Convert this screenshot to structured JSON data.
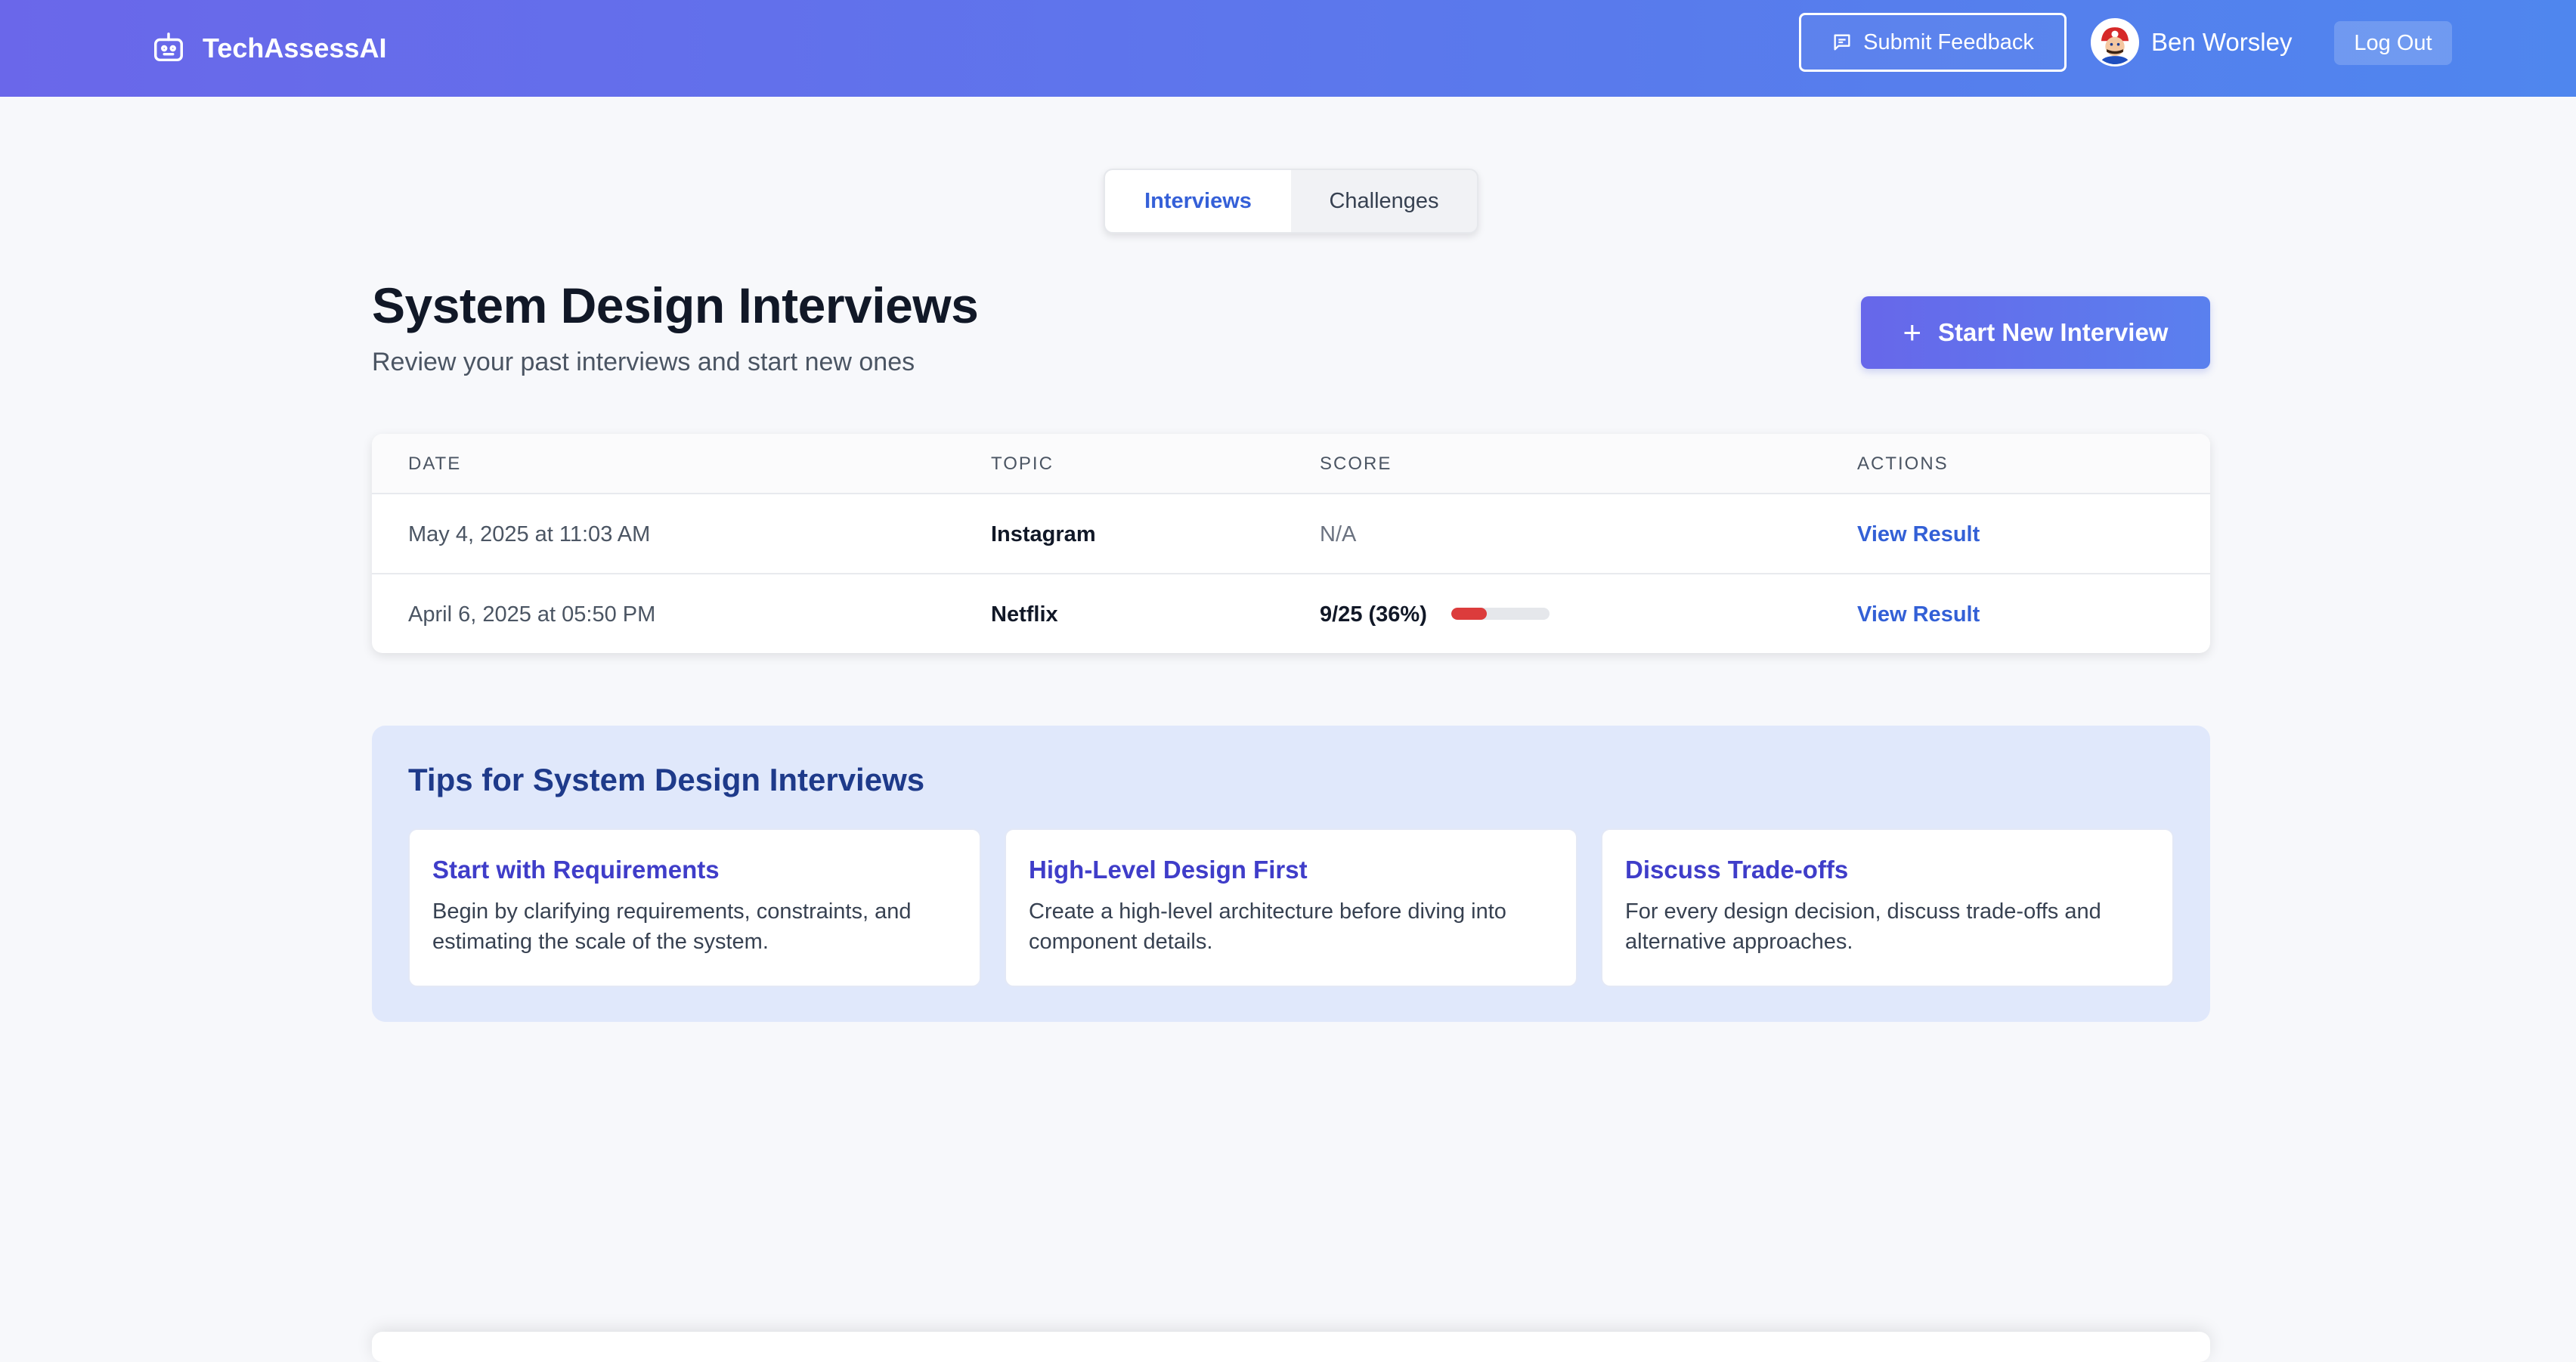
{
  "header": {
    "brand": "TechAssessAI",
    "brand_icon": "robot-icon",
    "feedback_label": "Submit Feedback",
    "feedback_icon": "message-icon",
    "user_name": "Ben Worsley",
    "logout_label": "Log Out"
  },
  "tabs": [
    {
      "label": "Interviews",
      "active": true
    },
    {
      "label": "Challenges",
      "active": false
    }
  ],
  "page": {
    "title": "System Design Interviews",
    "subtitle": "Review your past interviews and start new ones",
    "start_button": "Start New Interview",
    "start_icon": "plus-icon"
  },
  "table": {
    "headers": [
      "DATE",
      "TOPIC",
      "SCORE",
      "ACTIONS"
    ],
    "rows": [
      {
        "date": "May 4, 2025 at 11:03 AM",
        "topic": "Instagram",
        "score": "N/A",
        "action": "View Result"
      },
      {
        "date": "April 6, 2025 at 05:50 PM",
        "topic": "Netflix",
        "score": "9/25 (36%)",
        "score_fraction": 0.36,
        "action": "View Result"
      }
    ]
  },
  "tips": {
    "title": "Tips for System Design Interviews",
    "items": [
      {
        "title": "Start with Requirements",
        "body": "Begin by clarifying requirements, constraints, and estimating the scale of the system."
      },
      {
        "title": "High-Level Design First",
        "body": "Create a high-level architecture before diving into component details."
      },
      {
        "title": "Discuss Trade-offs",
        "body": "For every design decision, discuss trade-offs and alternative approaches."
      }
    ]
  },
  "colors": {
    "accent": "#3560d8",
    "score_low": "#dc3c3c",
    "tips_bg": "#e0e8fb"
  }
}
